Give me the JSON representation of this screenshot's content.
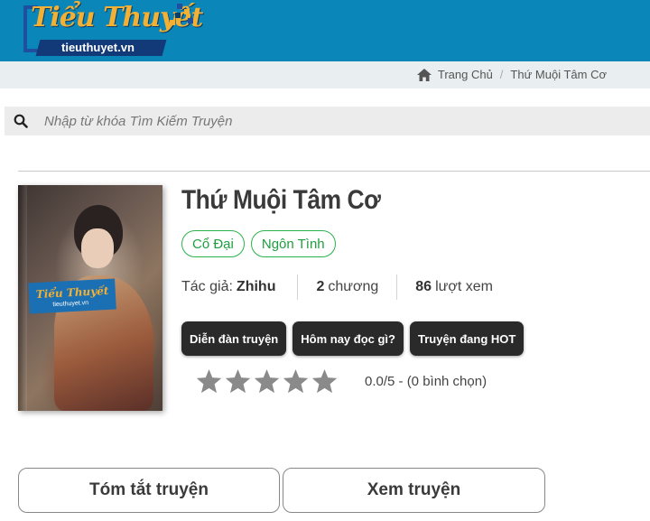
{
  "header": {
    "logo_main": "Tiểu Thuyết",
    "logo_sub": "tieuthuyet.vn",
    "colors": {
      "background": "#0a86b8",
      "logo_gold": "#f2b134",
      "logo_navy": "#123a78"
    }
  },
  "breadcrumb": {
    "home_icon": "home-icon",
    "items": [
      "Trang Chủ",
      "Thứ Muội Tâm Cơ"
    ],
    "separator": "/"
  },
  "search": {
    "icon": "search-icon",
    "placeholder": "Nhập từ khóa Tìm Kiếm Truyện",
    "value": ""
  },
  "book": {
    "title": "Thứ Muội Tâm Cơ",
    "genres": [
      "Cổ Đại",
      "Ngôn Tình"
    ],
    "author_label": "Tác giả:",
    "author": "Zhihu",
    "chapters_count": "2",
    "chapters_label": "chương",
    "views_count": "86",
    "views_label": "lượt xem",
    "cover_badge": "Tiểu Thuyết",
    "cover_badge_sub": "tieuthuyet.vn"
  },
  "links": [
    "Diễn đàn truyện",
    "Hôm nay đọc gì?",
    "Truyện đang HOT"
  ],
  "rating": {
    "score": 0.0,
    "max": 5,
    "stars_filled": 0,
    "text": "0.0/5 - (0 bình chọn)"
  },
  "tabs": [
    "Tóm tắt truyện",
    "Xem truyện"
  ],
  "colors": {
    "genre_green": "#1e9e3f",
    "star_gray": "#8a8a8a",
    "link_button_bg": "#2a2a2a"
  }
}
